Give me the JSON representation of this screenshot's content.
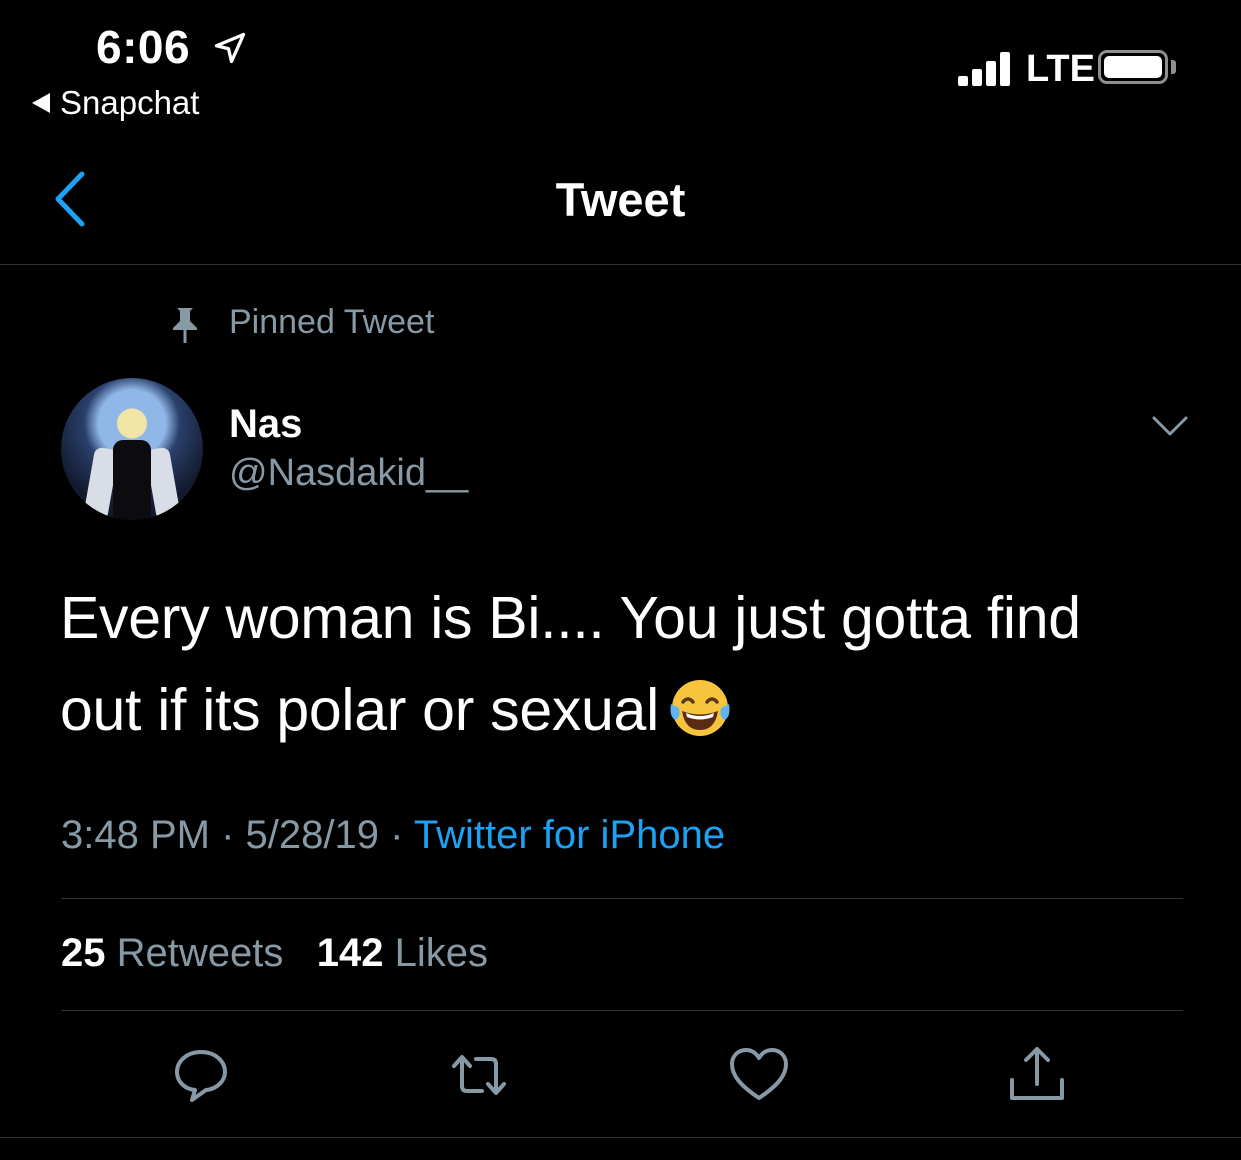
{
  "status_bar": {
    "time": "6:06",
    "back_app": "Snapchat",
    "network": "LTE",
    "signal_bars": 4,
    "battery_level": 1.0
  },
  "nav": {
    "title": "Tweet",
    "back_icon": "chevron-left-icon"
  },
  "tweet": {
    "pinned_label": "Pinned Tweet",
    "author_name": "Nas",
    "author_handle": "@Nasdakid__",
    "text_line1": "Every woman is Bi.... You just gotta find",
    "text_line2": "out if its polar or sexual",
    "emoji": "face-with-tears-of-joy",
    "time": "3:48 PM",
    "date": "5/28/19",
    "separator": "·",
    "source": "Twitter for iPhone",
    "retweets_count": "25",
    "retweets_label": "Retweets",
    "likes_count": "142",
    "likes_label": "Likes"
  },
  "actions": [
    "reply-icon",
    "retweet-icon",
    "like-icon",
    "share-icon"
  ],
  "colors": {
    "background": "#000000",
    "accent": "#1da1f2",
    "secondary_text": "#8899a6",
    "divider": "#2f3336"
  }
}
